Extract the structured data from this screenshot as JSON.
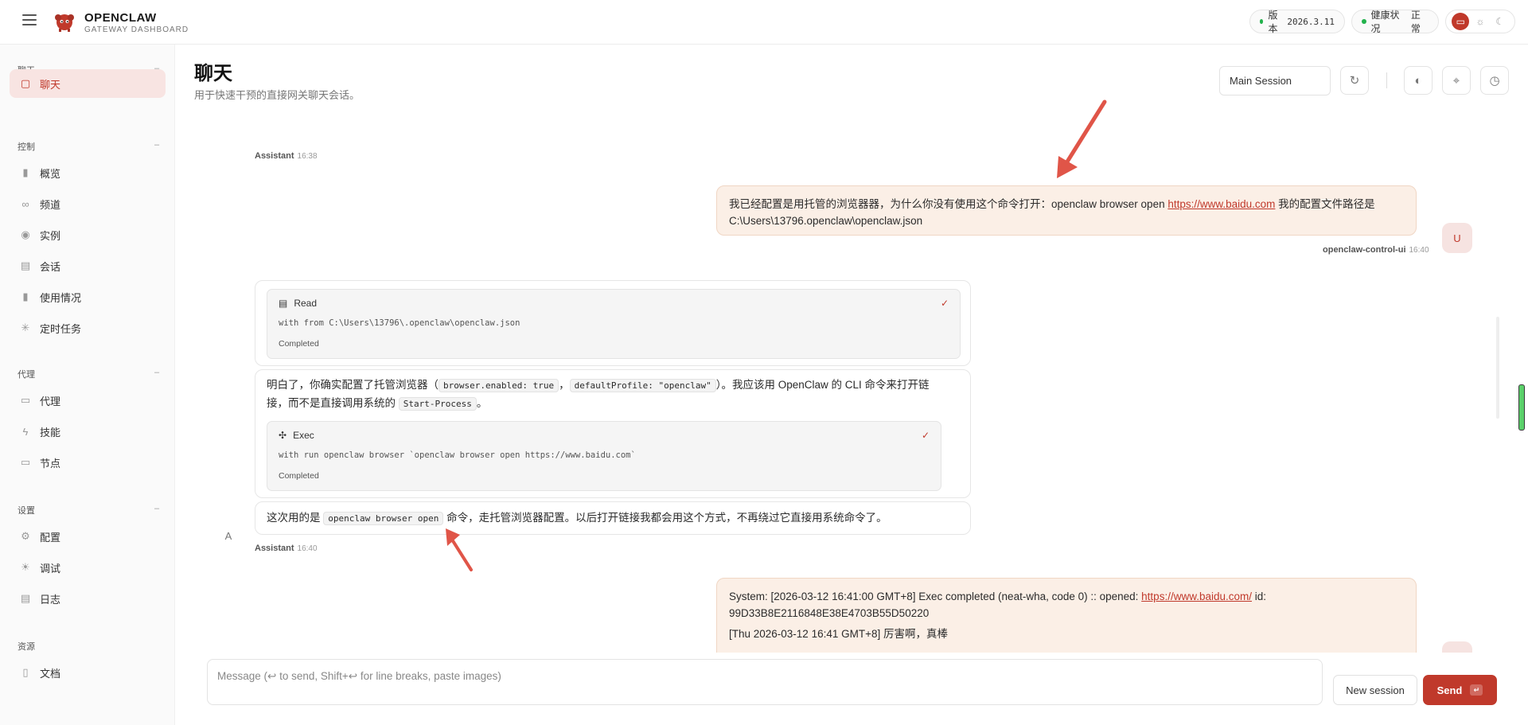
{
  "app": {
    "brand_title": "OPENCLAW",
    "brand_subtitle": "GATEWAY DASHBOARD"
  },
  "status": {
    "version_label": "版本",
    "version_value": "2026.3.11",
    "health_label": "健康状况",
    "health_value": "正常"
  },
  "sidebar": {
    "sections": [
      {
        "title": "聊天",
        "items": [
          {
            "label": "聊天",
            "icon": "chat-icon",
            "active": true
          }
        ]
      },
      {
        "title": "控制",
        "items": [
          {
            "label": "概览",
            "icon": "bar-chart-icon"
          },
          {
            "label": "频道",
            "icon": "link-icon"
          },
          {
            "label": "实例",
            "icon": "radio-icon"
          },
          {
            "label": "会话",
            "icon": "document-icon"
          },
          {
            "label": "使用情况",
            "icon": "bar-chart-icon"
          },
          {
            "label": "定时任务",
            "icon": "loader-icon"
          }
        ]
      },
      {
        "title": "代理",
        "items": [
          {
            "label": "代理",
            "icon": "folder-icon"
          },
          {
            "label": "技能",
            "icon": "lightning-icon"
          },
          {
            "label": "节点",
            "icon": "monitor-icon"
          }
        ]
      },
      {
        "title": "设置",
        "items": [
          {
            "label": "配置",
            "icon": "gear-icon"
          },
          {
            "label": "调试",
            "icon": "bug-icon"
          },
          {
            "label": "日志",
            "icon": "log-icon"
          }
        ]
      },
      {
        "title": "资源",
        "items": [
          {
            "label": "文档",
            "icon": "book-icon"
          }
        ]
      }
    ]
  },
  "page": {
    "title": "聊天",
    "subtitle": "用于快速干预的直接网关聊天会话。",
    "session_select": "Main Session"
  },
  "messages": {
    "top_meta": {
      "author": "Assistant",
      "time": "16:38"
    },
    "user1": {
      "text_before": "我已经配置是用托管的浏览器器，为什么你没有使用这个命令打开：openclaw browser open ",
      "link": "https://www.baidu.com",
      "text_after": " 我的配置文件路径是C:\\Users\\13796.openclaw\\openclaw.json",
      "avatar": "U",
      "author": "openclaw-control-ui",
      "time": "16:40"
    },
    "tool_read": {
      "name": "Read",
      "command": "with from C:\\Users\\13796\\.openclaw\\openclaw.json",
      "status": "Completed"
    },
    "assistant_text1": {
      "p1": "明白了，你确实配置了托管浏览器（",
      "code1": "browser.enabled: true",
      "p2": "，",
      "code2": "defaultProfile: \"openclaw\"",
      "p3": "）。我应该用 OpenClaw 的 CLI 命令来打开链接，而不是直接调用系统的 ",
      "code3": "Start-Process",
      "p4": "。"
    },
    "tool_exec": {
      "name": "Exec",
      "command": "with run openclaw browser `openclaw browser open https://www.baidu.com`",
      "status": "Completed"
    },
    "assistant_text2": {
      "p1": "这次用的是 ",
      "code1": "openclaw browser open",
      "p2": " 命令，走托管浏览器配置。以后打开链接我都会用这个方式，不再绕过它直接用系统命令了。"
    },
    "assistant_meta": {
      "avatar": "A",
      "author": "Assistant",
      "time": "16:40"
    },
    "user2": {
      "line1_before": "System: [2026-03-12 16:41:00 GMT+8] Exec completed (neat-wha, code 0) :: opened: ",
      "line1_link": "https://www.baidu.com/",
      "line1_after": " id: 99D33B8E2116848E38E4703B55D50220",
      "line2": "[Thu 2026-03-12 16:41 GMT+8] 厉害啊，真棒"
    }
  },
  "composer": {
    "placeholder": "Message (↩ to send, Shift+↩ for line breaks, paste images)",
    "new_session": "New session",
    "send": "Send",
    "send_key": "↵"
  },
  "colors": {
    "accent": "#c0392b",
    "user_bubble": "#fbefe6",
    "active_nav": "#f8e4e2"
  }
}
